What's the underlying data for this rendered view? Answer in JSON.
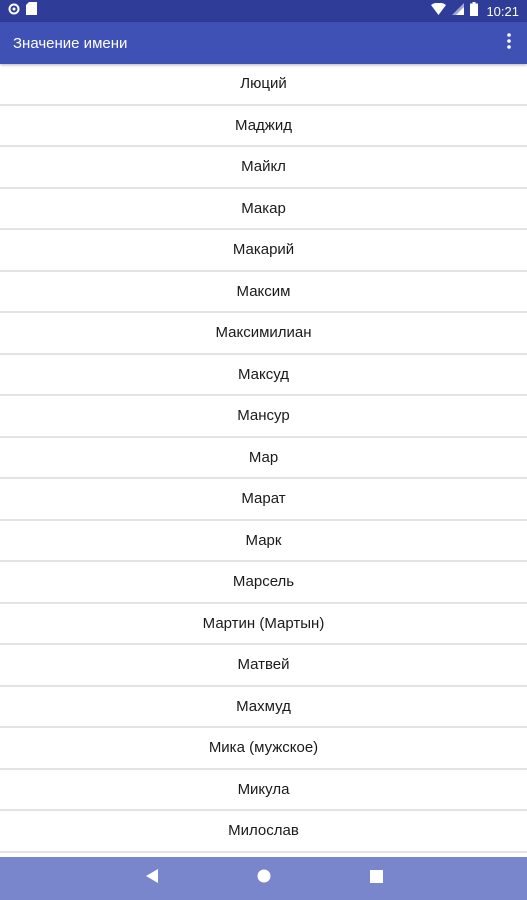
{
  "status_bar": {
    "time": "10:21",
    "icons": [
      "notification-circle-icon",
      "sd-card-icon",
      "wifi-icon",
      "signal-icon",
      "battery-icon"
    ]
  },
  "app_bar": {
    "title": "Значение имени",
    "menu_icon": "overflow-menu-icon"
  },
  "names": [
    "Люций",
    "Маджид",
    "Майкл",
    "Макар",
    "Макарий",
    "Максим",
    "Максимилиан",
    "Максуд",
    "Мансур",
    "Мар",
    "Марат",
    "Марк",
    "Марсель",
    "Мартин (Мартын)",
    "Матвей",
    "Махмуд",
    "Мика (мужское)",
    "Микула",
    "Милослав"
  ],
  "nav_bar": {
    "icons": [
      "back-icon",
      "home-icon",
      "recents-icon"
    ]
  },
  "colors": {
    "status_bar": "#2f3d99",
    "app_bar": "#3f51b5",
    "nav_bar": "#7986cb",
    "divider": "#e3e3e3"
  }
}
